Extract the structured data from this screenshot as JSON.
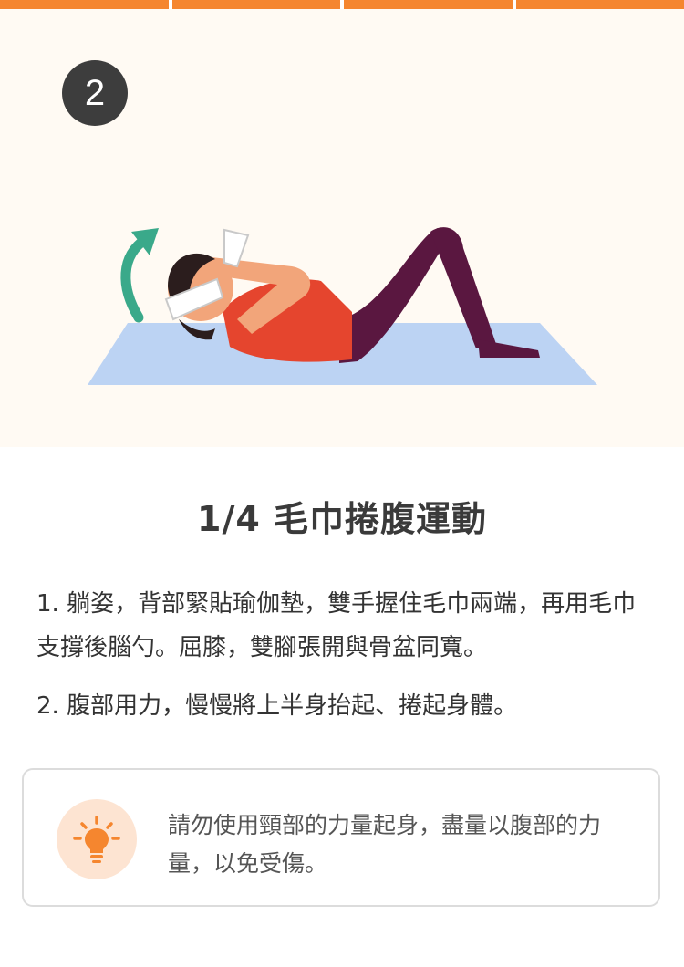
{
  "progress": {
    "total_segments": 4,
    "current_segment": 1,
    "color": "#f5862f"
  },
  "step": {
    "number": "2"
  },
  "exercise": {
    "title": "1/4 毛巾捲腹運動"
  },
  "instructions": [
    "1. 躺姿，背部緊貼瑜伽墊，雙手握住毛巾兩端，再用毛巾支撐後腦勺。屈膝，雙腳張開與骨盆同寬。",
    "2. 腹部用力，慢慢將上半身抬起、捲起身體。"
  ],
  "tip": {
    "icon": "lightbulb-icon",
    "text": "請勿使用頸部的力量起身，盡量以腹部的力量，以免受傷。"
  },
  "colors": {
    "accent": "#f5862f",
    "hero_bg": "#fffaf3",
    "arrow": "#3aa98a",
    "mat": "#bcd3f3"
  }
}
